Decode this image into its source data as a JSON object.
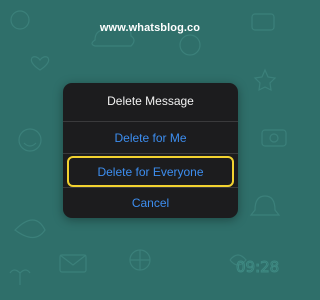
{
  "page": {
    "site_url": "www.whatsblog.co"
  },
  "dialog": {
    "title": "Delete Message",
    "actions": [
      {
        "label": "Delete for Me"
      },
      {
        "label": "Delete for Everyone",
        "highlighted": true
      },
      {
        "label": "Cancel"
      }
    ]
  },
  "colors": {
    "wallpaper": "#2f6f6a",
    "dialog_background": "#1c1c1e",
    "action_text": "#3d8ef0",
    "highlight": "#f2d230"
  },
  "wallpaper_doodle": "09:28"
}
